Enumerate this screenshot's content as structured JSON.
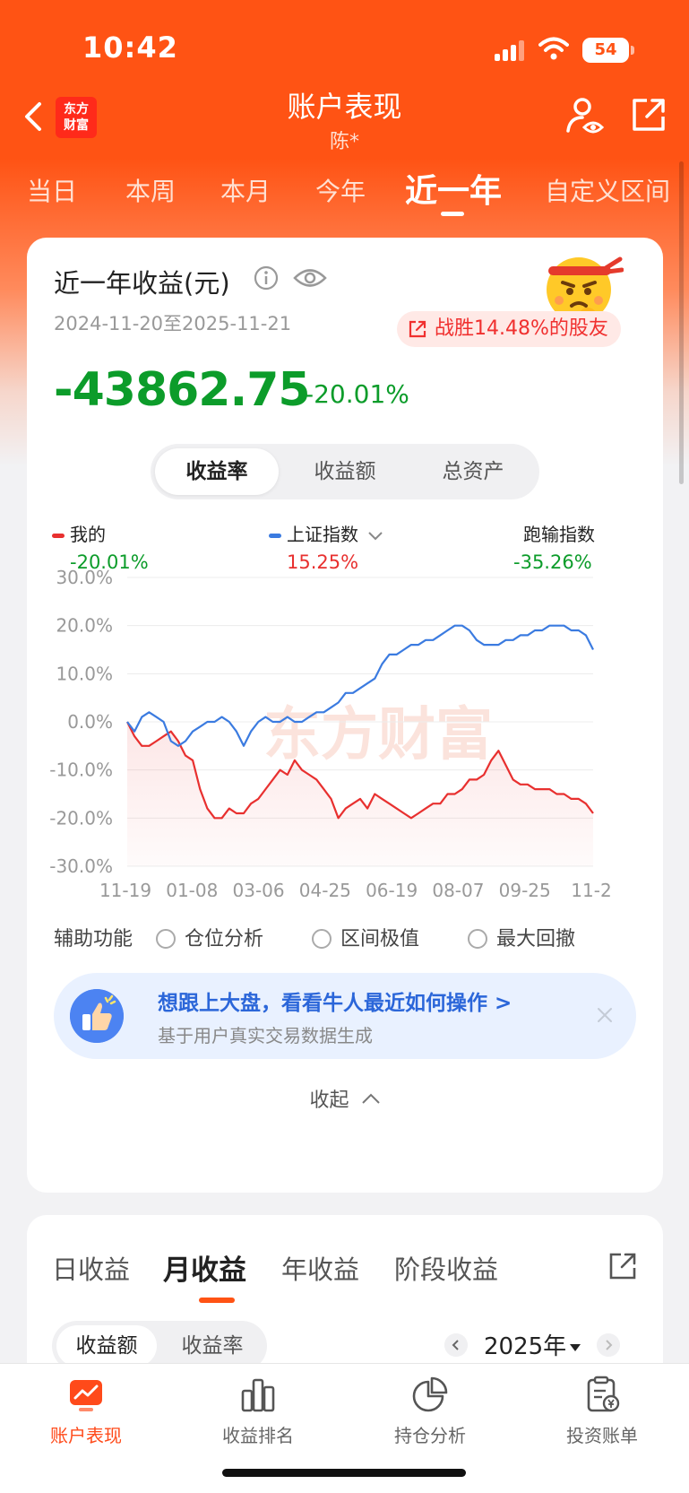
{
  "status": {
    "time": "10:42",
    "battery": "54"
  },
  "header": {
    "brand": "东方\n财富",
    "title": "账户表现",
    "subtitle": "陈*"
  },
  "period_tabs": [
    "当日",
    "本周",
    "本月",
    "今年",
    "近一年",
    "自定义区间"
  ],
  "active_period": "近一年",
  "summary": {
    "title": "近一年收益(元)",
    "date_range": "2024-11-20至2025-11-21",
    "beat_badge": "战胜14.48%的股友",
    "total_value": "-43862.75",
    "total_pct": "-20.01%",
    "metric_tabs": [
      "收益率",
      "收益额",
      "总资产"
    ]
  },
  "legend": [
    {
      "name": "我的",
      "value": "-20.01%",
      "color": "#e8302f",
      "value_color": "#0c9c2a"
    },
    {
      "name": "上证指数",
      "value": "15.25%",
      "color": "#3b7be0",
      "value_color": "#e8302f"
    },
    {
      "name": "跑输指数",
      "value": "-35.26%",
      "value_color": "#0c9c2a"
    }
  ],
  "chart_data": {
    "type": "line",
    "x_ticks": [
      "11-19",
      "01-08",
      "03-06",
      "04-25",
      "06-19",
      "08-07",
      "09-25",
      "11-2"
    ],
    "y_ticks": [
      "30.0%",
      "20.0%",
      "10.0%",
      "0.0%",
      "-10.0%",
      "-20.0%",
      "-30.0%"
    ],
    "ylim": [
      -30,
      30
    ],
    "watermark": "东方财富",
    "series": [
      {
        "name": "我的",
        "color": "#e8302f",
        "values": [
          0,
          -3,
          -5,
          -5,
          -4,
          -3,
          -2,
          -4,
          -7,
          -8,
          -14,
          -18,
          -20,
          -20,
          -18,
          -19,
          -19,
          -17,
          -16,
          -14,
          -12,
          -10,
          -11,
          -8,
          -10,
          -11,
          -12,
          -14,
          -16,
          -20,
          -18,
          -17,
          -16,
          -18,
          -15,
          -16,
          -17,
          -18,
          -19,
          -20,
          -19,
          -18,
          -17,
          -17,
          -15,
          -15,
          -14,
          -12,
          -12,
          -11,
          -8,
          -6,
          -9,
          -12,
          -13,
          -13,
          -14,
          -14,
          -14,
          -15,
          -15,
          -16,
          -16,
          -17,
          -19
        ]
      },
      {
        "name": "上证指数",
        "color": "#3b7be0",
        "values": [
          0,
          -2,
          1,
          2,
          1,
          0,
          -4,
          -5,
          -4,
          -2,
          -1,
          0,
          0,
          1,
          0,
          -2,
          -5,
          -2,
          0,
          1,
          0,
          0,
          1,
          0,
          0,
          1,
          2,
          2,
          3,
          4,
          6,
          6,
          7,
          8,
          9,
          12,
          14,
          14,
          15,
          16,
          16,
          17,
          17,
          18,
          19,
          20,
          20,
          19,
          17,
          16,
          16,
          16,
          17,
          17,
          18,
          18,
          19,
          19,
          20,
          20,
          20,
          19,
          19,
          18,
          15
        ]
      }
    ]
  },
  "aux": {
    "label": "辅助功能",
    "options": [
      "仓位分析",
      "区间极值",
      "最大回撤"
    ]
  },
  "promo": {
    "title": "想跟上大盘，看看牛人最近如何操作 >",
    "subtitle": "基于用户真实交易数据生成"
  },
  "collapse_label": "收起",
  "earnings": {
    "tabs": [
      "日收益",
      "月收益",
      "年收益",
      "阶段收益"
    ],
    "active": "月收益",
    "sub_tabs": [
      "收益额",
      "收益率"
    ],
    "year": "2025年"
  },
  "tabbar": [
    {
      "label": "账户表现",
      "icon": "trend-icon"
    },
    {
      "label": "收益排名",
      "icon": "bar-chart-icon"
    },
    {
      "label": "持仓分析",
      "icon": "pie-chart-icon"
    },
    {
      "label": "投资账单",
      "icon": "bill-icon"
    }
  ]
}
